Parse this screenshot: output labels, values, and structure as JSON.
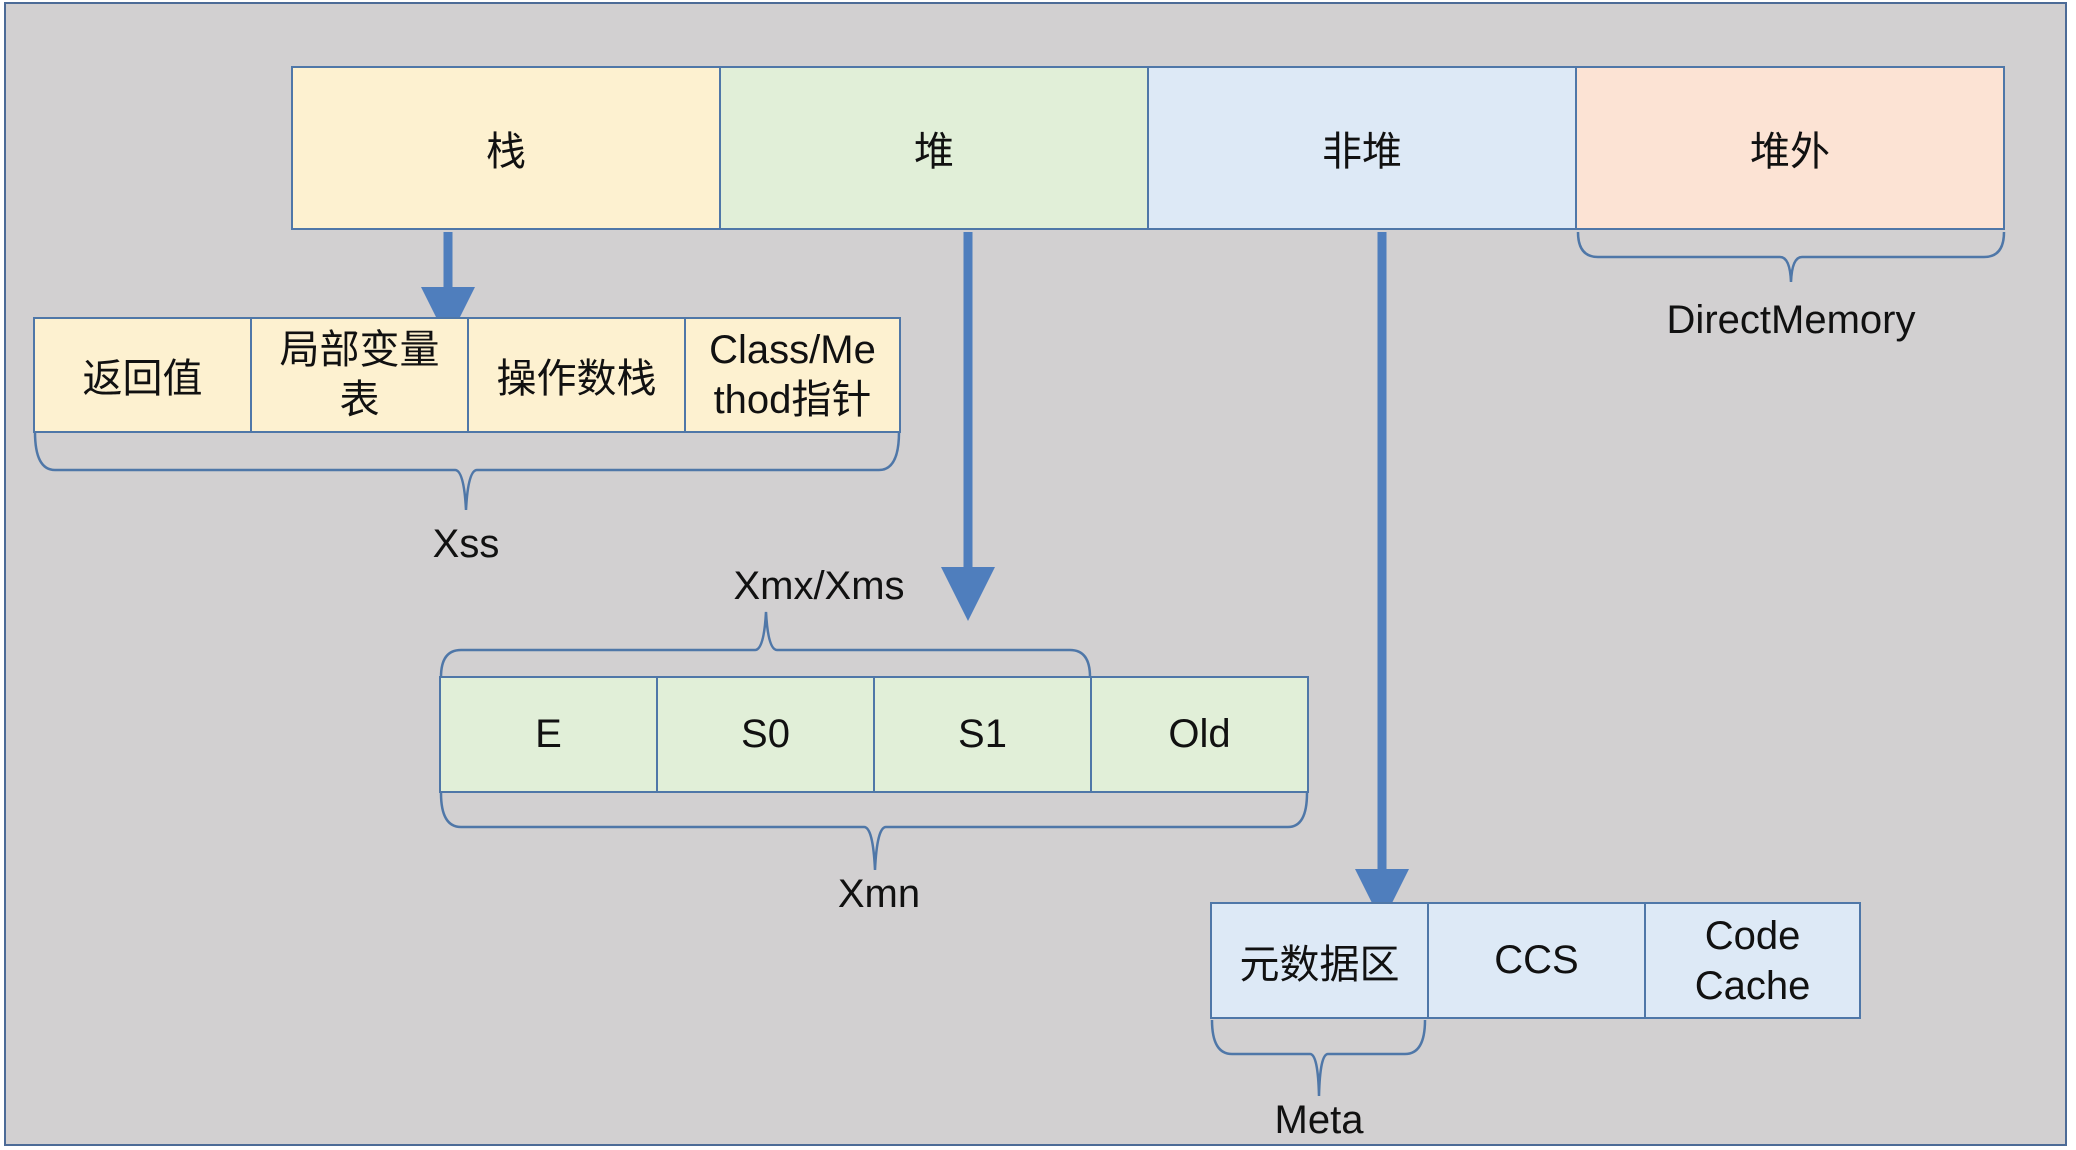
{
  "memory": {
    "stack": "栈",
    "heap": "堆",
    "non_heap": "非堆",
    "off_heap": "堆外"
  },
  "stack_frame": {
    "items": [
      "返回值",
      "局部变量表",
      "操作数栈",
      "Class/Method指针"
    ],
    "item_lines": [
      [
        "返回值"
      ],
      [
        "局部变量",
        "表"
      ],
      [
        "操作数栈"
      ],
      [
        "Class/Me",
        "thod指针"
      ]
    ],
    "brace_label": "Xss"
  },
  "heap_detail": {
    "top_label": "Xmx/Xms",
    "items": [
      "E",
      "S0",
      "S1",
      "Old"
    ],
    "brace_label": "Xmn"
  },
  "non_heap_detail": {
    "items": [
      "元数据区",
      "CCS",
      "Code Cache"
    ],
    "item_lines": [
      [
        "元数据区"
      ],
      [
        "CCS"
      ],
      [
        "Code",
        "Cache"
      ]
    ],
    "brace_label": "Meta"
  },
  "off_heap_detail": {
    "brace_label": "DirectMemory"
  },
  "colors": {
    "background": "#d2d0d1",
    "border": "#4f77a8",
    "arrow": "#4f7ebd",
    "stack_fill": "#fdf1d0",
    "heap_fill": "#e1efd8",
    "non_heap_fill": "#dde9f6",
    "off_heap_fill": "#fce3d4"
  }
}
